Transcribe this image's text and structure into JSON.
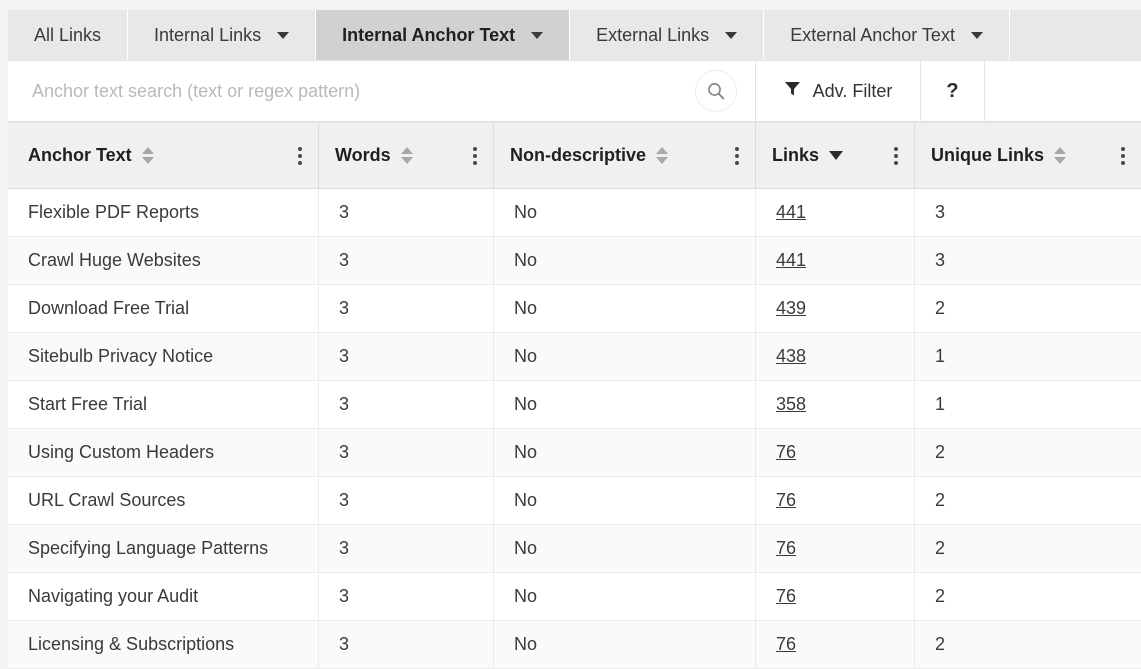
{
  "tabs": [
    {
      "label": "All Links",
      "has_caret": false,
      "active": false
    },
    {
      "label": "Internal Links",
      "has_caret": true,
      "active": false
    },
    {
      "label": "Internal Anchor Text",
      "has_caret": true,
      "active": true
    },
    {
      "label": "External Links",
      "has_caret": true,
      "active": false
    },
    {
      "label": "External Anchor Text",
      "has_caret": true,
      "active": false
    }
  ],
  "search": {
    "placeholder": "Anchor text search (text or regex pattern)",
    "value": "",
    "search_icon": "search-icon",
    "adv_filter_label": "Adv. Filter",
    "adv_filter_icon": "funnel-icon",
    "help_label": "?"
  },
  "table": {
    "columns": [
      {
        "label": "Anchor Text",
        "sort": "none",
        "menu": "column-menu-icon"
      },
      {
        "label": "Words",
        "sort": "none",
        "menu": "column-menu-icon"
      },
      {
        "label": "Non-descriptive",
        "sort": "none",
        "menu": "column-menu-icon"
      },
      {
        "label": "Links",
        "sort": "desc",
        "menu": "column-menu-icon"
      },
      {
        "label": "Unique Links",
        "sort": "none",
        "menu": "column-menu-icon"
      }
    ],
    "rows": [
      {
        "anchor_text": "Flexible PDF Reports",
        "words": "3",
        "non_descriptive": "No",
        "links": "441",
        "unique_links": "3"
      },
      {
        "anchor_text": "Crawl Huge Websites",
        "words": "3",
        "non_descriptive": "No",
        "links": "441",
        "unique_links": "3"
      },
      {
        "anchor_text": "Download Free Trial",
        "words": "3",
        "non_descriptive": "No",
        "links": "439",
        "unique_links": "2"
      },
      {
        "anchor_text": "Sitebulb Privacy Notice",
        "words": "3",
        "non_descriptive": "No",
        "links": "438",
        "unique_links": "1"
      },
      {
        "anchor_text": "Start Free Trial",
        "words": "3",
        "non_descriptive": "No",
        "links": "358",
        "unique_links": "1"
      },
      {
        "anchor_text": "Using Custom Headers",
        "words": "3",
        "non_descriptive": "No",
        "links": "76",
        "unique_links": "2"
      },
      {
        "anchor_text": "URL Crawl Sources",
        "words": "3",
        "non_descriptive": "No",
        "links": "76",
        "unique_links": "2"
      },
      {
        "anchor_text": "Specifying Language Patterns",
        "words": "3",
        "non_descriptive": "No",
        "links": "76",
        "unique_links": "2"
      },
      {
        "anchor_text": "Navigating your Audit",
        "words": "3",
        "non_descriptive": "No",
        "links": "76",
        "unique_links": "2"
      },
      {
        "anchor_text": "Licensing & Subscriptions",
        "words": "3",
        "non_descriptive": "No",
        "links": "76",
        "unique_links": "2"
      }
    ]
  },
  "colors": {
    "page_background": "#f4f4f4",
    "tab_inactive": "#e8e8e8",
    "tab_active": "#d1d1d1",
    "header_background": "#f0f0f0",
    "row_background": "#ffffff",
    "row_alt_background": "#fafafa",
    "text": "#3a3a3a",
    "placeholder": "#b9b9b9"
  }
}
